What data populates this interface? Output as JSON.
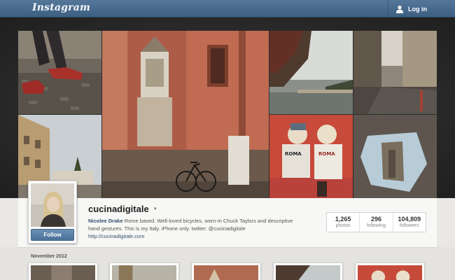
{
  "header": {
    "logo_text": "Instagram",
    "login_label": "Log in",
    "user_icon": "user-icon",
    "bar_color": "#4a6c8f"
  },
  "profile": {
    "username": "cucinadigitale",
    "caret_icon": "chevron-down-icon",
    "full_name": "Nicolee Drake",
    "bio": " Rome based. Well-loved bicycles, worn-in Chuck Taylors and descriptive hand gestures. This is my Italy. iPhone only. twitter: @cucinadigitale",
    "website": "http://cucinadigitale.com",
    "follow_label": "Follow",
    "stats": [
      {
        "value": "1,265",
        "label": "photos"
      },
      {
        "value": "296",
        "label": "following"
      },
      {
        "value": "104,809",
        "label": "followers"
      }
    ]
  },
  "feed": {
    "month_label": "November 2012"
  },
  "colors": {
    "accent": "#4b729a",
    "link": "#33506f"
  }
}
